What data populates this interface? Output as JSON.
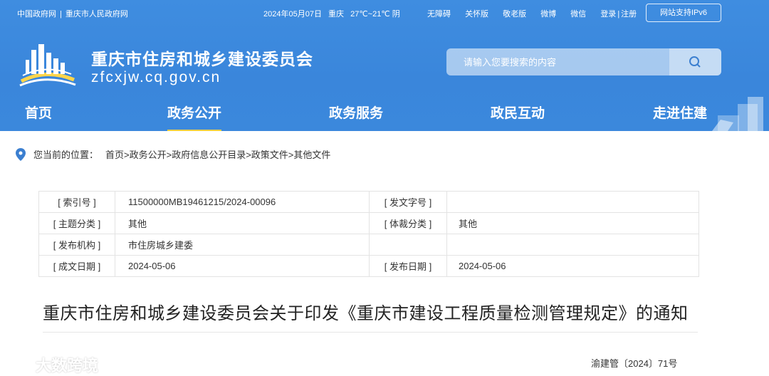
{
  "top_bar": {
    "links": [
      "中国政府网",
      "重庆市人民政府网"
    ],
    "separator": "|",
    "date": "2024年05月07日",
    "city": "重庆",
    "weather": "27℃~21℃ 阴",
    "tools": [
      "无障碍",
      "关怀版",
      "敬老版",
      "微博",
      "微信"
    ],
    "login": "登录",
    "register": "注册",
    "login_sep": "|",
    "ipv6": "网站支持IPv6"
  },
  "brand": {
    "title": "重庆市住房和城乡建设委员会",
    "domain": "zfcxjw.cq.gov.cn"
  },
  "search": {
    "placeholder": "请输入您要搜索的内容"
  },
  "nav": {
    "items": [
      "首页",
      "政务公开",
      "政务服务",
      "政民互动",
      "走进住建"
    ],
    "active": "政务公开"
  },
  "breadcrumb": {
    "label": "您当前的位置：",
    "path": "首页>政务公开>政府信息公开目录>政策文件>其他文件"
  },
  "info": {
    "rows": [
      {
        "k1": "[ 索引号 ]",
        "v1": "11500000MB19461215/2024-00096",
        "k2": "[ 发文字号 ]",
        "v2": ""
      },
      {
        "k1": "[ 主题分类 ]",
        "v1": "其他",
        "k2": "[ 体裁分类 ]",
        "v2": "其他"
      },
      {
        "k1": "[ 发布机构 ]",
        "v1": "市住房城乡建委",
        "k2": "",
        "v2": ""
      },
      {
        "k1": "[ 成文日期 ]",
        "v1": "2024-05-06",
        "k2": "[ 发布日期 ]",
        "v2": "2024-05-06"
      }
    ]
  },
  "document": {
    "title": "重庆市住房和城乡建设委员会关于印发《重庆市建设工程质量检测管理规定》的通知",
    "number": "渝建管〔2024〕71号"
  },
  "watermark": {
    "text": "大数跨境"
  },
  "colors": {
    "header_blue": "#3b88dc",
    "nav_active_underline": "#ffcf3d"
  }
}
